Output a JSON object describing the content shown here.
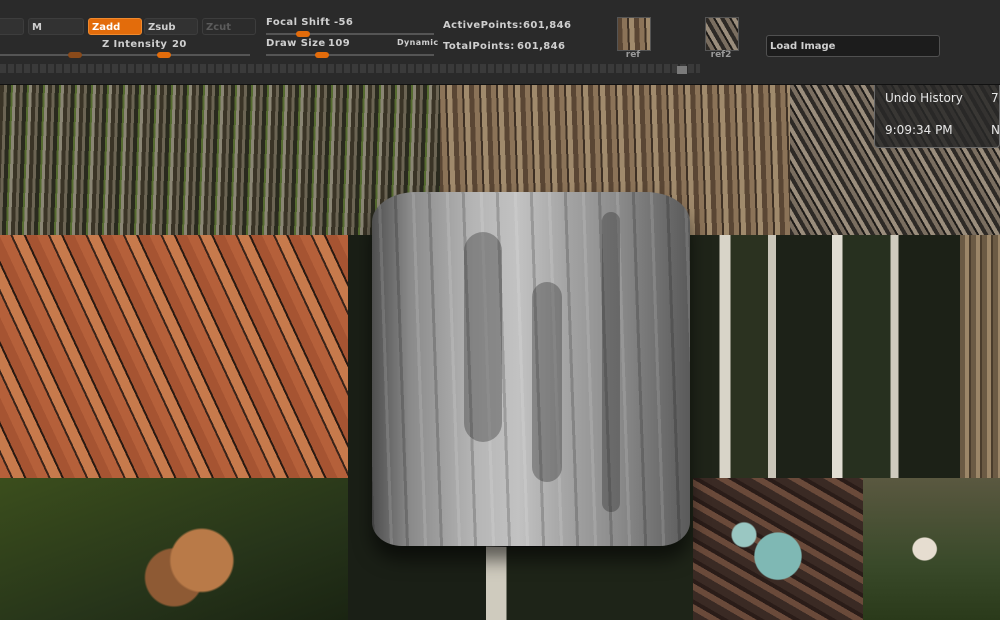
{
  "toolbar": {
    "m_button": "M",
    "zadd_button": "Zadd",
    "zsub_button": "Zsub",
    "zcut_button": "Zcut",
    "z_intensity_label": "Z Intensity",
    "z_intensity_value": "20",
    "focal_shift_label": "Focal Shift",
    "focal_shift_value": "-56",
    "draw_size_label": "Draw Size",
    "draw_size_value": "109",
    "dynamic_label": "Dynamic",
    "active_points_label": "ActivePoints:",
    "active_points_value": "601,846",
    "total_points_label": "TotalPoints:",
    "total_points_value": "601,846",
    "thumb1_label": "ref",
    "thumb2_label": "ref2",
    "load_image": "Load Image"
  },
  "undo_panel": {
    "title": "Undo History",
    "title_suffix": "7",
    "time": "9:09:34 PM",
    "time_suffix": "N"
  },
  "colors": {
    "accent": "#e36c0b",
    "toolbar_bg": "#2a2a2a",
    "text": "#cfcfcf"
  },
  "icons": [
    "ref-thumbnail",
    "ref2-thumbnail"
  ]
}
